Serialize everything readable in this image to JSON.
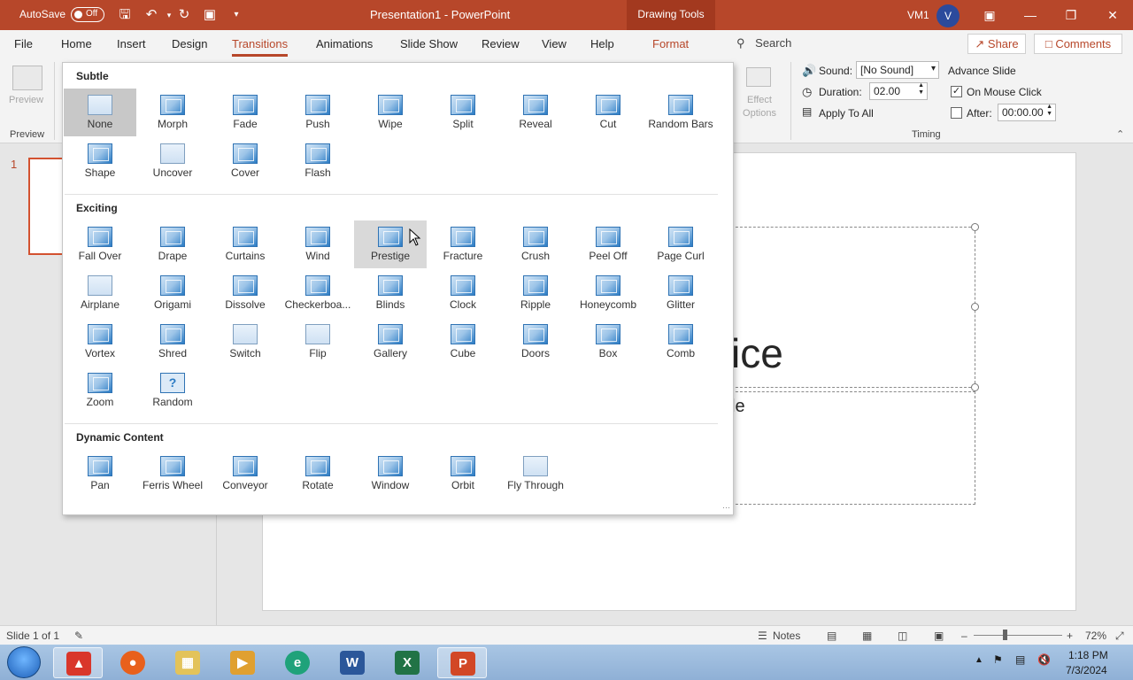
{
  "titlebar": {
    "autosave_label": "AutoSave",
    "autosave_state": "Off",
    "document_title": "Presentation1  -  PowerPoint",
    "contextual_tab_group": "Drawing Tools",
    "user_name": "VM1",
    "avatar_letter": "V"
  },
  "tabs": [
    "File",
    "Home",
    "Insert",
    "Design",
    "Transitions",
    "Animations",
    "Slide Show",
    "Review",
    "View",
    "Help",
    "Format"
  ],
  "active_tab": "Transitions",
  "search_label": "Search",
  "share_label": "Share",
  "comments_label": "Comments",
  "ribbon": {
    "preview_button": "Preview",
    "preview_group": "Preview",
    "effect_options": "Effect\nOptions",
    "sound_label": "Sound:",
    "sound_value": "[No Sound]",
    "duration_label": "Duration:",
    "duration_value": "02.00",
    "apply_to_all": "Apply To All",
    "advance_slide": "Advance Slide",
    "on_mouse_click": "On Mouse Click",
    "on_mouse_click_checked": true,
    "after_label": "After:",
    "after_value": "00:00.00",
    "timing_group": "Timing"
  },
  "gallery": {
    "sections": [
      {
        "heading": "Subtle",
        "items": [
          "None",
          "Morph",
          "Fade",
          "Push",
          "Wipe",
          "Split",
          "Reveal",
          "Cut",
          "Random Bars",
          "Shape",
          "Uncover",
          "Cover",
          "Flash"
        ]
      },
      {
        "heading": "Exciting",
        "items": [
          "Fall Over",
          "Drape",
          "Curtains",
          "Wind",
          "Prestige",
          "Fracture",
          "Crush",
          "Peel Off",
          "Page Curl",
          "Airplane",
          "Origami",
          "Dissolve",
          "Checkerboa...",
          "Blinds",
          "Clock",
          "Ripple",
          "Honeycomb",
          "Glitter",
          "Vortex",
          "Shred",
          "Switch",
          "Flip",
          "Gallery",
          "Cube",
          "Doors",
          "Box",
          "Comb",
          "Zoom",
          "Random"
        ]
      },
      {
        "heading": "Dynamic Content",
        "items": [
          "Pan",
          "Ferris Wheel",
          "Conveyor",
          "Rotate",
          "Window",
          "Orbit",
          "Fly Through"
        ]
      }
    ],
    "selected": "None",
    "hovered": "Prestige"
  },
  "slides_pane": {
    "slide_number": "1"
  },
  "slide": {
    "title_fragment": "ice",
    "subtitle_fragment": "le"
  },
  "statusbar": {
    "slide_counter": "Slide 1 of 1",
    "notes_label": "Notes",
    "zoom_percent": "72%"
  },
  "taskbar": {
    "time": "1:18 PM",
    "date": "7/3/2024",
    "apps": [
      "app-red-icon",
      "firefox-icon",
      "file-explorer-icon",
      "media-player-icon",
      "edge-icon",
      "word-icon",
      "excel-icon",
      "powerpoint-icon"
    ],
    "active_app": "powerpoint-icon"
  },
  "colors": {
    "accent": "#b7472a",
    "gallery_selected": "#c8c8c8",
    "icon_blue": "#2a7bc4"
  }
}
